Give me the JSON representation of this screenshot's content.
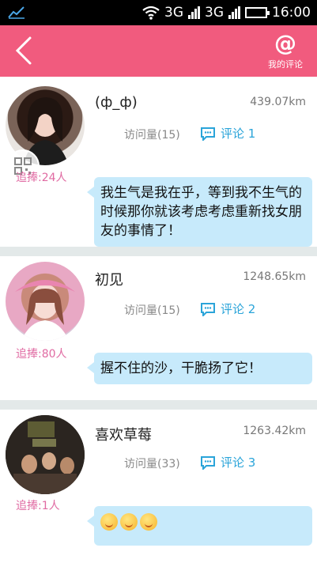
{
  "statusbar": {
    "network_1": "3G",
    "network_2": "3G",
    "time": "16:00"
  },
  "header": {
    "back_icon": "chevron-left-icon",
    "my_comments_icon": "at-icon",
    "my_comments_symbol": "@",
    "my_comments_label": "我的评论"
  },
  "posts": [
    {
      "name": "(ф_ф)",
      "distance": "439.07km",
      "visits": "访问量(15)",
      "comment": "评论 1",
      "fans": "追捧:24人",
      "message": "我生气是我在乎，等到我不生气的时候那你就该考虑考虑重新找女朋友的事情了！"
    },
    {
      "name": "初见",
      "distance": "1248.65km",
      "visits": "访问量(15)",
      "comment": "评论 2",
      "fans": "追捧:80人",
      "message": "握不住的沙，干脆扬了它！"
    },
    {
      "name": "喜欢草莓",
      "distance": "1263.42km",
      "visits": "访问量(33)",
      "comment": "评论 3",
      "fans": "追捧:1人",
      "message_emoji_count": 3
    }
  ],
  "colors": {
    "header": "#f15b7e",
    "bubble": "#c7eafb",
    "fans_text": "#e06aa2",
    "comment_text": "#2aa4d9"
  }
}
